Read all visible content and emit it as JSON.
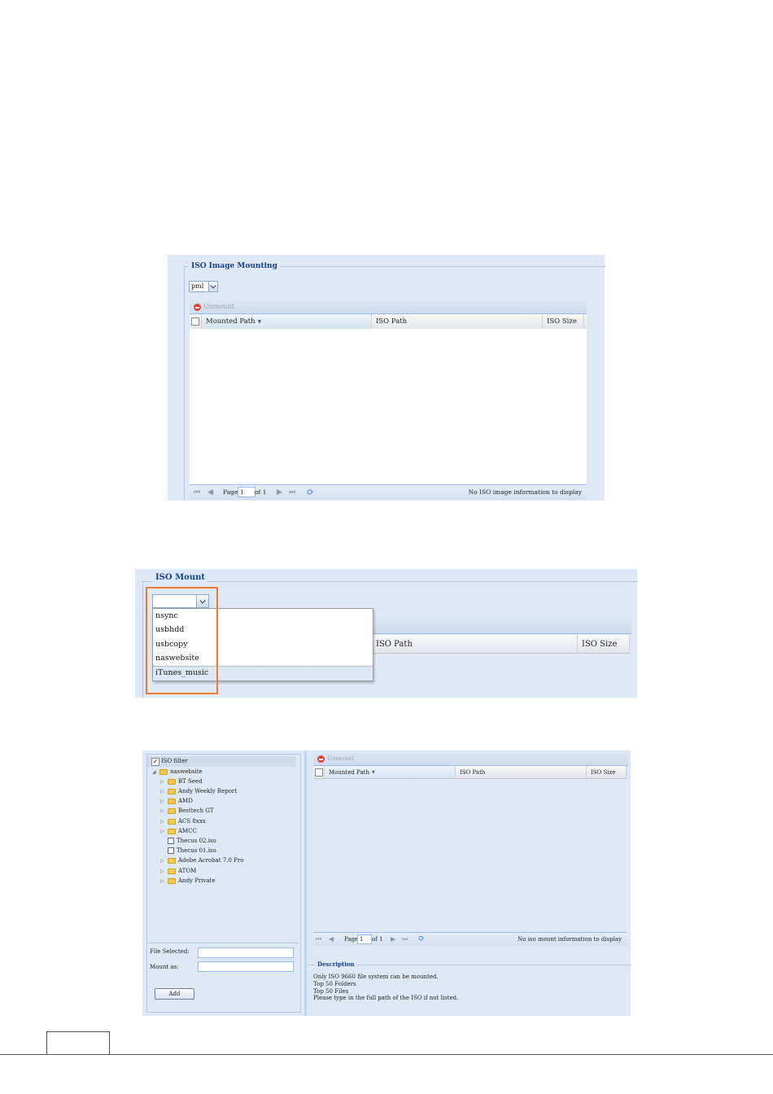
{
  "shot1": {
    "legend": "ISO Image Mounting",
    "select_value": "pml",
    "toolbar": {
      "unmount_label": "Unmount"
    },
    "columns": [
      "Mounted Path",
      "ISO Path",
      "ISO Size"
    ],
    "pager": {
      "page_label": "Page",
      "page_value": "1",
      "of_label": "of 1",
      "status": "No ISO image information to display"
    }
  },
  "shot2": {
    "legend": "ISO Mount",
    "select_value": "",
    "options": [
      "nsync",
      "usbhdd",
      "usbcopy",
      "naswebsite",
      "iTunes_music"
    ],
    "highlighted_option": "iTunes_music",
    "columns": [
      "ISO Path",
      "ISO Size"
    ],
    "highlight_color": "#ee7a2a"
  },
  "shot3": {
    "filter_label": "ISO filter",
    "tree": {
      "root": "naswebsite",
      "items": [
        {
          "label": "BT Seed",
          "icon": "folder-icon"
        },
        {
          "label": "Andy Weekly Report",
          "icon": "folder-icon"
        },
        {
          "label": "AMD",
          "icon": "folder-icon"
        },
        {
          "label": "Besttech GT",
          "icon": "folder-icon"
        },
        {
          "label": "ACS 8xxx",
          "icon": "folder-icon"
        },
        {
          "label": "AMCC",
          "icon": "folder-icon"
        },
        {
          "label": "Thecus 02.iso",
          "icon": "iso-file-icon"
        },
        {
          "label": "Thecus 01.iso",
          "icon": "iso-file-icon"
        },
        {
          "label": "Adobe Acrobat 7.0 Pro",
          "icon": "folder-icon"
        },
        {
          "label": "ATOM",
          "icon": "folder-icon"
        },
        {
          "label": "Andy Private",
          "icon": "folder-icon"
        }
      ]
    },
    "form": {
      "file_selected_label": "File Selected:",
      "mount_as_label": "Mount as:",
      "add_label": "Add"
    },
    "toolbar": {
      "unmount_label": "Unmount"
    },
    "columns": [
      "Mounted Path",
      "ISO Path",
      "ISO Size"
    ],
    "pager": {
      "page_label": "Page",
      "page_value": "1",
      "of_label": "of 1",
      "status": "No iso mount information to display"
    },
    "description": {
      "title": "Description",
      "lines": [
        "Only ISO 9660 file system can be mounted.",
        "Top 50 Folders",
        "Top 50 Files",
        "Please type in the full path of the ISO if not listed."
      ]
    }
  }
}
